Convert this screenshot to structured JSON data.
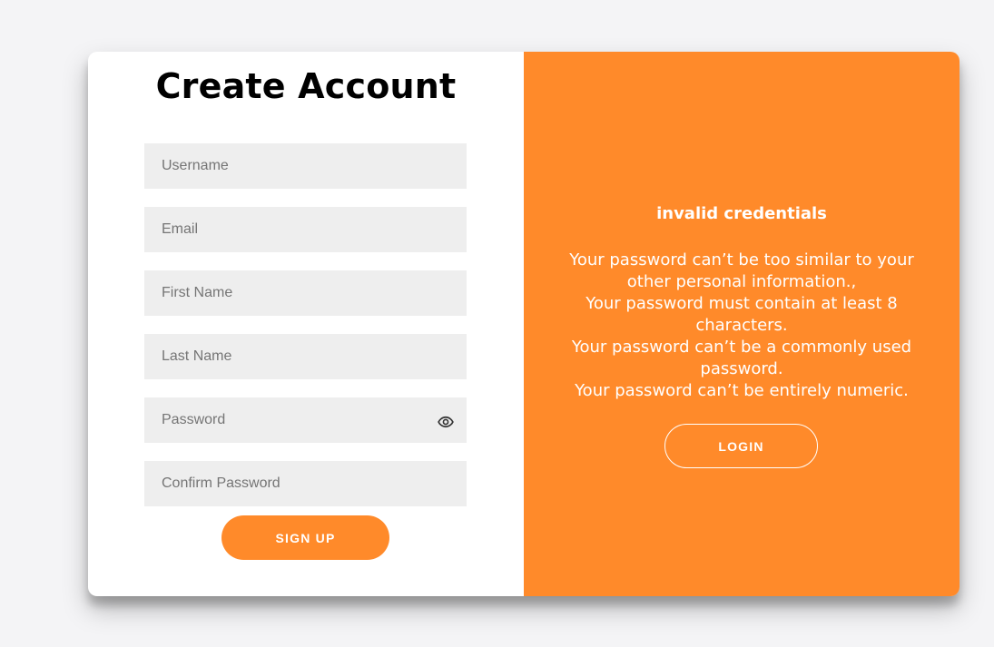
{
  "signup_form": {
    "title": "Create Account",
    "fields": [
      {
        "name": "username",
        "placeholder": "Username",
        "value": ""
      },
      {
        "name": "email",
        "placeholder": "Email",
        "value": ""
      },
      {
        "name": "first_name",
        "placeholder": "First Name",
        "value": ""
      },
      {
        "name": "last_name",
        "placeholder": "Last Name",
        "value": ""
      },
      {
        "name": "password",
        "placeholder": "Password",
        "value": ""
      },
      {
        "name": "confirm_password",
        "placeholder": "Confirm Password",
        "value": ""
      }
    ],
    "password_toggle_icon": "eye-icon",
    "submit_label": "SIGN UP"
  },
  "overlay_panel": {
    "message_title": "invalid credentials",
    "errors": [
      "Your password can’t be too similar to your other personal information.,",
      "Your password must contain at least 8 characters.",
      "Your password can’t be a commonly used password.",
      "Your password can’t be entirely numeric."
    ],
    "login_label": "LOGIN"
  },
  "colors": {
    "accent": "#ff8a2a",
    "input_background": "#eeeeee",
    "page_background": "#f4f4f6"
  }
}
